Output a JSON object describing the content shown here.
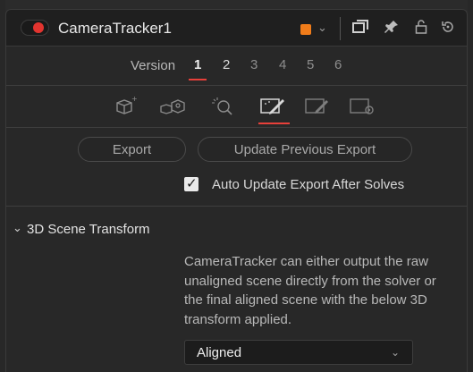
{
  "header": {
    "tool_name": "CameraTracker1",
    "color_swatch": "#f07c1a",
    "icons": [
      "enable-toggle-icon",
      "chevron-down-icon",
      "view-icon",
      "pin-icon",
      "lock-icon",
      "reset-icon"
    ]
  },
  "versions": {
    "label": "Version",
    "numbers": [
      "1",
      "2",
      "3",
      "4",
      "5",
      "6"
    ],
    "active": "1"
  },
  "tabs": [
    "track-tab-icon",
    "camera-tab-icon",
    "solve-tab-icon",
    "export-tab-icon",
    "export-edit-tab-icon",
    "options-tab-icon"
  ],
  "export": {
    "export_label": "Export",
    "update_label": "Update Previous Export",
    "auto_update_label": "Auto Update Export After Solves",
    "auto_update_checked": true
  },
  "section": {
    "title": "3D Scene Transform",
    "description": "CameraTracker can either output the raw unaligned scene directly from the solver or the final aligned scene with the below 3D transform applied.",
    "dropdown_value": "Aligned"
  }
}
